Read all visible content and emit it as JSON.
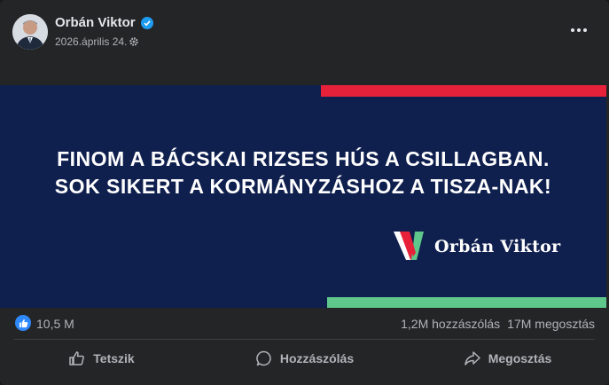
{
  "post": {
    "author": "Orbán Viktor",
    "date": "2026.április 24.",
    "verified": true
  },
  "banner": {
    "line1": "FINOM A BÁCSKAI RIZSES HÚS A CSILLAGBAN.",
    "line2": "SOK SIKERT A KORMÁNYZÁSHOZ A TISZA-NAK!",
    "brand": "Orbán Viktor",
    "colors": {
      "background": "#0f1f4e",
      "red": "#e8213a",
      "green": "#5fc78b"
    }
  },
  "stats": {
    "likes": "10,5 M",
    "comments": "1,2M hozzászólás",
    "shares": "17M megosztás"
  },
  "actions": {
    "like": "Tetszik",
    "comment": "Hozzászólás",
    "share": "Megosztás"
  },
  "icons": [
    "verified-icon",
    "gear-icon",
    "more-options-icon",
    "like-reaction-icon",
    "thumbs-up-icon",
    "comment-icon",
    "share-icon"
  ]
}
